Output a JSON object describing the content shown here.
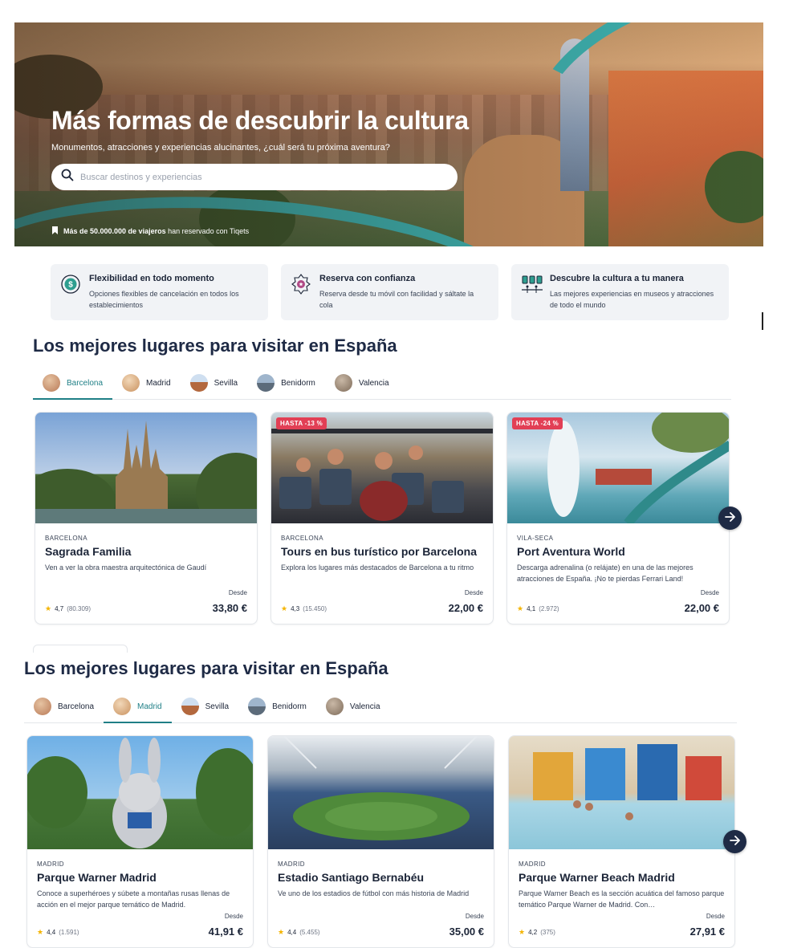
{
  "hero": {
    "title": "Más formas de descubrir la cultura",
    "subtitle": "Monumentos, atracciones y experiencias alucinantes, ¿cuál será tu próxima aventura?",
    "search_placeholder": "Buscar destinos y experiencias",
    "trust_bold": "Más de 50.000.000 de viajeros",
    "trust_rest": "han reservado con Tiqets",
    "accent_color": "#3db2b0"
  },
  "features": [
    {
      "icon": "refund-icon",
      "title": "Flexibilidad en todo momento",
      "desc": "Opciones flexibles de cancelación en todos los establecimientos"
    },
    {
      "icon": "badge-icon",
      "title": "Reserva con confianza",
      "desc": "Reserva desde tu móvil con facilidad y sáltate la cola"
    },
    {
      "icon": "museum-icon",
      "title": "Descubre la cultura a tu manera",
      "desc": "Las mejores experiencias en museos y atracciones de todo el mundo"
    }
  ],
  "section1": {
    "title": "Los mejores lugares para visitar en España",
    "tabs": [
      "Barcelona",
      "Madrid",
      "Sevilla",
      "Benidorm",
      "Valencia"
    ],
    "active_tab": "Barcelona",
    "cards": [
      {
        "badge": "",
        "location": "BARCELONA",
        "name": "Sagrada Familia",
        "desc": "Ven a ver la obra maestra arquitectónica de Gaudí",
        "rating": "4,7",
        "count": "(80.309)",
        "from": "Desde",
        "price": "33,80 €"
      },
      {
        "badge": "HASTA -13 %",
        "location": "BARCELONA",
        "name": "Tours en bus turístico por Barcelona",
        "desc": "Explora los lugares más destacados de Barcelona a tu ritmo",
        "rating": "4,3",
        "count": "(15.450)",
        "from": "Desde",
        "price": "22,00 €"
      },
      {
        "badge": "HASTA -24 %",
        "location": "VILA-SECA",
        "name": "Port Aventura World",
        "desc": "Descarga adrenalina (o relájate) en una de las mejores atracciones de España. ¡No te pierdas Ferrari Land!",
        "rating": "4,1",
        "count": "(2.972)",
        "from": "Desde",
        "price": "22,00 €"
      }
    ]
  },
  "section2": {
    "title": "Los mejores lugares para visitar en España",
    "tabs": [
      "Barcelona",
      "Madrid",
      "Sevilla",
      "Benidorm",
      "Valencia"
    ],
    "active_tab": "Madrid",
    "cards": [
      {
        "location": "MADRID",
        "name": "Parque Warner Madrid",
        "desc": "Conoce a superhéroes y súbete a montañas rusas llenas de acción en el mejor parque temático de Madrid.",
        "rating": "4,4",
        "count": "(1.591)",
        "from": "Desde",
        "price": "41,91 €"
      },
      {
        "location": "MADRID",
        "name": "Estadio Santiago Bernabéu",
        "desc": "Ve uno de los estadios de fútbol con más historia de Madrid",
        "rating": "4,4",
        "count": "(5.455)",
        "from": "Desde",
        "price": "35,00 €"
      },
      {
        "location": "MADRID",
        "name": "Parque Warner Beach Madrid",
        "desc": "Parque Warner Beach es la sección acuática del famoso parque temático Parque Warner de Madrid. Con…",
        "rating": "4,2",
        "count": "(375)",
        "from": "Desde",
        "price": "27,91 €"
      }
    ]
  },
  "colors": {
    "brand_teal": "#1f7f86",
    "navy": "#1e2a45",
    "sale": "#e23f55",
    "star": "#f4b400"
  }
}
